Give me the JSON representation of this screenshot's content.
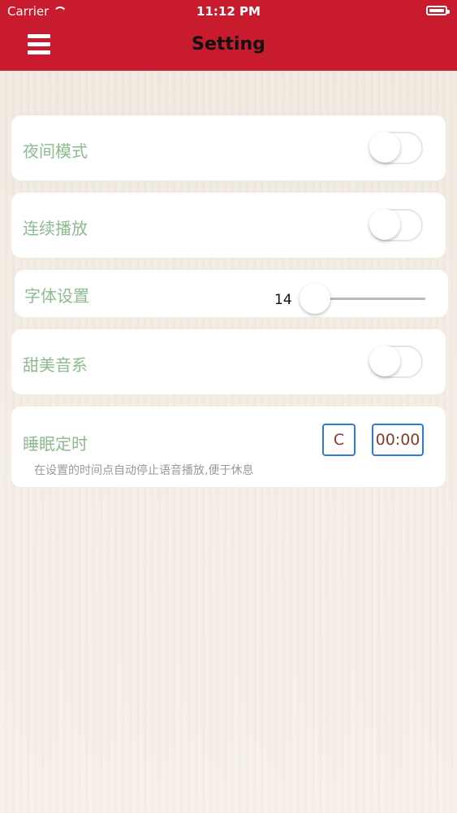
{
  "status_bar": {
    "carrier": "Carrier",
    "time": "11:12 PM",
    "icons": [
      "wifi-icon",
      "battery-icon"
    ]
  },
  "header": {
    "title": "Setting",
    "menu_icon": "hamburger-menu-icon",
    "accent_color": "#c81b2e"
  },
  "settings": {
    "night_mode": {
      "label": "夜间模式",
      "on": false
    },
    "continuous_play": {
      "label": "连续播放",
      "on": false
    },
    "font_size": {
      "label": "字体设置",
      "value": "14",
      "level": 0.0
    },
    "sweet_voice": {
      "label": "甜美音系",
      "on": false
    },
    "sleep_timer": {
      "label": "睡眠定时",
      "cancel_label": "C",
      "time_value": "00:00",
      "hint": "在设置的时间点自动停止语音播放,便于休息"
    }
  },
  "colors": {
    "label_text": "#8dbb8d",
    "button_border": "#2e7ad6",
    "button_text": "#8a3a2a"
  }
}
